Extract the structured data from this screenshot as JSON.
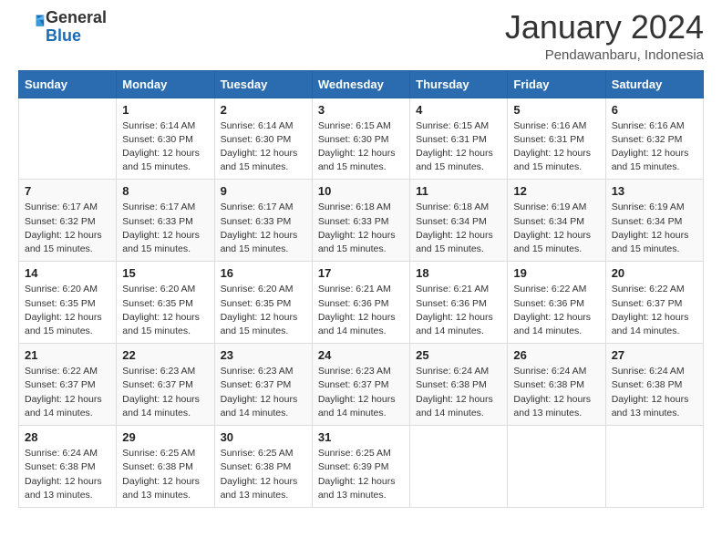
{
  "header": {
    "logo_general": "General",
    "logo_blue": "Blue",
    "month_title": "January 2024",
    "location": "Pendawanbaru, Indonesia"
  },
  "weekdays": [
    "Sunday",
    "Monday",
    "Tuesday",
    "Wednesday",
    "Thursday",
    "Friday",
    "Saturday"
  ],
  "weeks": [
    [
      {
        "day": "",
        "sunrise": "",
        "sunset": "",
        "daylight": ""
      },
      {
        "day": "1",
        "sunrise": "6:14 AM",
        "sunset": "6:30 PM",
        "daylight": "12 hours and 15 minutes."
      },
      {
        "day": "2",
        "sunrise": "6:14 AM",
        "sunset": "6:30 PM",
        "daylight": "12 hours and 15 minutes."
      },
      {
        "day": "3",
        "sunrise": "6:15 AM",
        "sunset": "6:30 PM",
        "daylight": "12 hours and 15 minutes."
      },
      {
        "day": "4",
        "sunrise": "6:15 AM",
        "sunset": "6:31 PM",
        "daylight": "12 hours and 15 minutes."
      },
      {
        "day": "5",
        "sunrise": "6:16 AM",
        "sunset": "6:31 PM",
        "daylight": "12 hours and 15 minutes."
      },
      {
        "day": "6",
        "sunrise": "6:16 AM",
        "sunset": "6:32 PM",
        "daylight": "12 hours and 15 minutes."
      }
    ],
    [
      {
        "day": "7",
        "sunrise": "6:17 AM",
        "sunset": "6:32 PM",
        "daylight": "12 hours and 15 minutes."
      },
      {
        "day": "8",
        "sunrise": "6:17 AM",
        "sunset": "6:33 PM",
        "daylight": "12 hours and 15 minutes."
      },
      {
        "day": "9",
        "sunrise": "6:17 AM",
        "sunset": "6:33 PM",
        "daylight": "12 hours and 15 minutes."
      },
      {
        "day": "10",
        "sunrise": "6:18 AM",
        "sunset": "6:33 PM",
        "daylight": "12 hours and 15 minutes."
      },
      {
        "day": "11",
        "sunrise": "6:18 AM",
        "sunset": "6:34 PM",
        "daylight": "12 hours and 15 minutes."
      },
      {
        "day": "12",
        "sunrise": "6:19 AM",
        "sunset": "6:34 PM",
        "daylight": "12 hours and 15 minutes."
      },
      {
        "day": "13",
        "sunrise": "6:19 AM",
        "sunset": "6:34 PM",
        "daylight": "12 hours and 15 minutes."
      }
    ],
    [
      {
        "day": "14",
        "sunrise": "6:20 AM",
        "sunset": "6:35 PM",
        "daylight": "12 hours and 15 minutes."
      },
      {
        "day": "15",
        "sunrise": "6:20 AM",
        "sunset": "6:35 PM",
        "daylight": "12 hours and 15 minutes."
      },
      {
        "day": "16",
        "sunrise": "6:20 AM",
        "sunset": "6:35 PM",
        "daylight": "12 hours and 15 minutes."
      },
      {
        "day": "17",
        "sunrise": "6:21 AM",
        "sunset": "6:36 PM",
        "daylight": "12 hours and 14 minutes."
      },
      {
        "day": "18",
        "sunrise": "6:21 AM",
        "sunset": "6:36 PM",
        "daylight": "12 hours and 14 minutes."
      },
      {
        "day": "19",
        "sunrise": "6:22 AM",
        "sunset": "6:36 PM",
        "daylight": "12 hours and 14 minutes."
      },
      {
        "day": "20",
        "sunrise": "6:22 AM",
        "sunset": "6:37 PM",
        "daylight": "12 hours and 14 minutes."
      }
    ],
    [
      {
        "day": "21",
        "sunrise": "6:22 AM",
        "sunset": "6:37 PM",
        "daylight": "12 hours and 14 minutes."
      },
      {
        "day": "22",
        "sunrise": "6:23 AM",
        "sunset": "6:37 PM",
        "daylight": "12 hours and 14 minutes."
      },
      {
        "day": "23",
        "sunrise": "6:23 AM",
        "sunset": "6:37 PM",
        "daylight": "12 hours and 14 minutes."
      },
      {
        "day": "24",
        "sunrise": "6:23 AM",
        "sunset": "6:37 PM",
        "daylight": "12 hours and 14 minutes."
      },
      {
        "day": "25",
        "sunrise": "6:24 AM",
        "sunset": "6:38 PM",
        "daylight": "12 hours and 14 minutes."
      },
      {
        "day": "26",
        "sunrise": "6:24 AM",
        "sunset": "6:38 PM",
        "daylight": "12 hours and 13 minutes."
      },
      {
        "day": "27",
        "sunrise": "6:24 AM",
        "sunset": "6:38 PM",
        "daylight": "12 hours and 13 minutes."
      }
    ],
    [
      {
        "day": "28",
        "sunrise": "6:24 AM",
        "sunset": "6:38 PM",
        "daylight": "12 hours and 13 minutes."
      },
      {
        "day": "29",
        "sunrise": "6:25 AM",
        "sunset": "6:38 PM",
        "daylight": "12 hours and 13 minutes."
      },
      {
        "day": "30",
        "sunrise": "6:25 AM",
        "sunset": "6:38 PM",
        "daylight": "12 hours and 13 minutes."
      },
      {
        "day": "31",
        "sunrise": "6:25 AM",
        "sunset": "6:39 PM",
        "daylight": "12 hours and 13 minutes."
      },
      {
        "day": "",
        "sunrise": "",
        "sunset": "",
        "daylight": ""
      },
      {
        "day": "",
        "sunrise": "",
        "sunset": "",
        "daylight": ""
      },
      {
        "day": "",
        "sunrise": "",
        "sunset": "",
        "daylight": ""
      }
    ]
  ],
  "labels": {
    "sunrise": "Sunrise:",
    "sunset": "Sunset:",
    "daylight": "Daylight:"
  }
}
